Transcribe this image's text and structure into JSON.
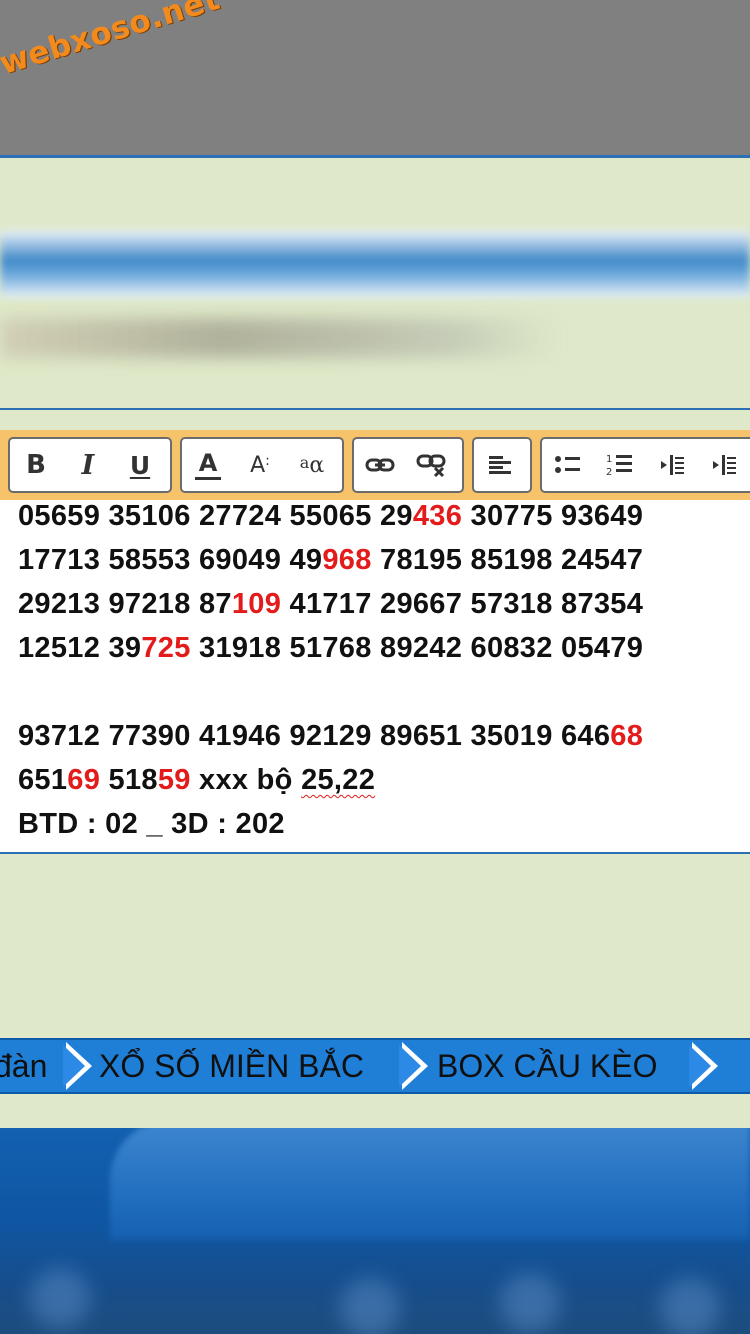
{
  "watermark": {
    "text": "webxoso.net"
  },
  "editor": {
    "toolbar": {
      "groups": [
        {
          "buttons": [
            {
              "label": "B",
              "icon": "bold-icon"
            },
            {
              "label": "I",
              "icon": "italic-icon"
            },
            {
              "label": "U",
              "icon": "underline-icon"
            }
          ]
        },
        {
          "buttons": [
            {
              "label": "A",
              "icon": "font-color-icon"
            },
            {
              "label": "A",
              "icon": "font-size-icon"
            },
            {
              "label": "a",
              "icon": "font-family-icon"
            }
          ]
        },
        {
          "buttons": [
            {
              "icon": "link-icon"
            },
            {
              "icon": "unlink-icon"
            }
          ]
        },
        {
          "buttons": [
            {
              "icon": "align-left-icon"
            }
          ]
        },
        {
          "buttons": [
            {
              "icon": "bullet-list-icon"
            },
            {
              "icon": "numbered-list-icon"
            },
            {
              "icon": "outdent-icon"
            },
            {
              "icon": "indent-icon"
            }
          ]
        }
      ]
    },
    "lines": [
      [
        {
          "t": "05659 35106 27724 55065 29"
        },
        {
          "t": "436",
          "red": true
        },
        {
          "t": " 30775 93649"
        }
      ],
      [
        {
          "t": "17713 58553 69049 49"
        },
        {
          "t": "968",
          "red": true
        },
        {
          "t": " 78195 85198 24547"
        }
      ],
      [
        {
          "t": "29213 97218 87"
        },
        {
          "t": "109",
          "red": true
        },
        {
          "t": " 41717 29667 57318 87354"
        }
      ],
      [
        {
          "t": "12512 39"
        },
        {
          "t": "725",
          "red": true
        },
        {
          "t": " 31918 51768 89242 60832 05479"
        }
      ],
      [],
      [
        {
          "t": "93712 77390 41946 92129 89651 35019 646"
        },
        {
          "t": "68",
          "red": true
        }
      ],
      [
        {
          "t": "651"
        },
        {
          "t": "69",
          "red": true
        },
        {
          "t": " 518"
        },
        {
          "t": "59",
          "red": true
        },
        {
          "t": " xxx bộ "
        },
        {
          "t": "25,22",
          "squiggle": true
        }
      ],
      [
        {
          "t": "BTD : 02 _ 3D : 202"
        }
      ]
    ]
  },
  "nav": {
    "items": [
      "đàn",
      "XỔ SỐ MIỀN BẮC",
      "BOX CẦU KÈO"
    ]
  },
  "colors": {
    "background": "#dfe9c9",
    "toolbar": "#f6c36b",
    "highlight_red": "#e31b1b",
    "nav_blue": "#1f7ed6",
    "watermark_orange": "#f28a1e"
  }
}
